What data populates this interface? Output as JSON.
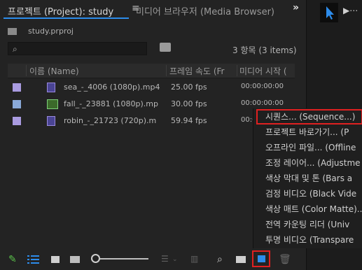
{
  "tabs": {
    "active": "프로젝트 (Project): study",
    "menu_icon": "≡",
    "inactive": "미디어 브라우저 (Media Browser)",
    "overflow": "»"
  },
  "project": {
    "file_name": "study.prproj",
    "search_placeholder": "",
    "item_count": "3 항목 (3 items)"
  },
  "table": {
    "columns": [
      "이름 (Name)",
      "프레임 속도 (Fr",
      "미디어 시작 ("
    ],
    "rows": [
      {
        "name": "sea_-_4006 (1080p).mp4",
        "fps": "25.00 fps",
        "media_start": "00:00:00:00",
        "label_color": "#a99be0"
      },
      {
        "name": "fall_-_23881 (1080p).mp",
        "fps": "30.00 fps",
        "media_start": "00:00:00:00",
        "label_color": "#8aa9d8"
      },
      {
        "name": "robin_-_21723 (720p).m",
        "fps": "59.94 fps",
        "media_start": "00:00:00:00",
        "label_color": "#a99be0"
      }
    ]
  },
  "context_menu": {
    "items": [
      "시퀀스... (Sequence...)",
      "프로젝트 바로가기... (P",
      "오프라인 파일... (Offline",
      "조정 레이어... (Adjustme",
      "색상 막대 및 톤 (Bars a",
      "검정 비디오 (Black Vide",
      "색상 매트 (Color Matte)...",
      "전역 카운팅 리더 (Univ",
      "투명 비디오 (Transpare"
    ],
    "highlighted_index": 0
  },
  "colors": {
    "accent": "#2d8ceb",
    "highlight": "#e02020"
  }
}
